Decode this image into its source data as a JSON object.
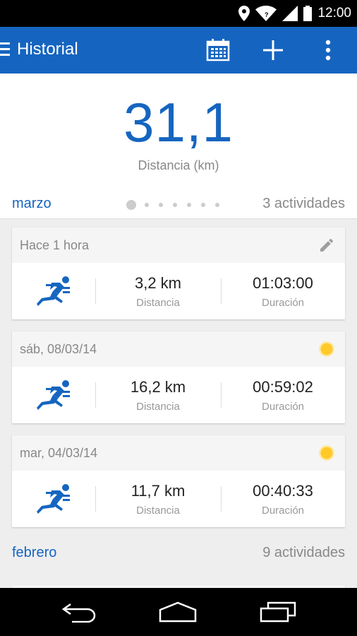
{
  "status_bar": {
    "time": "12:00"
  },
  "app_bar": {
    "title": "Historial"
  },
  "summary": {
    "value": "31,1",
    "label": "Distancia (km)"
  },
  "months": [
    {
      "name": "marzo",
      "count": "3 actividades",
      "page_dots": 7,
      "active_dot": 0
    },
    {
      "name": "febrero",
      "count": "9 actividades"
    }
  ],
  "activities": [
    {
      "date": "Hace 1 hora",
      "status_icon": "edit-icon",
      "distance": "3,2 km",
      "distance_label": "Distancia",
      "duration": "01:03:00",
      "duration_label": "Duración"
    },
    {
      "date": "sáb, 08/03/14",
      "status_icon": "sun-icon",
      "distance": "16,2 km",
      "distance_label": "Distancia",
      "duration": "00:59:02",
      "duration_label": "Duración"
    },
    {
      "date": "mar, 04/03/14",
      "status_icon": "sun-icon",
      "distance": "11,7 km",
      "distance_label": "Distancia",
      "duration": "00:40:33",
      "duration_label": "Duración"
    }
  ],
  "colors": {
    "primary": "#1565c0",
    "sun": "#ffca28",
    "status_bar": "#000000"
  }
}
